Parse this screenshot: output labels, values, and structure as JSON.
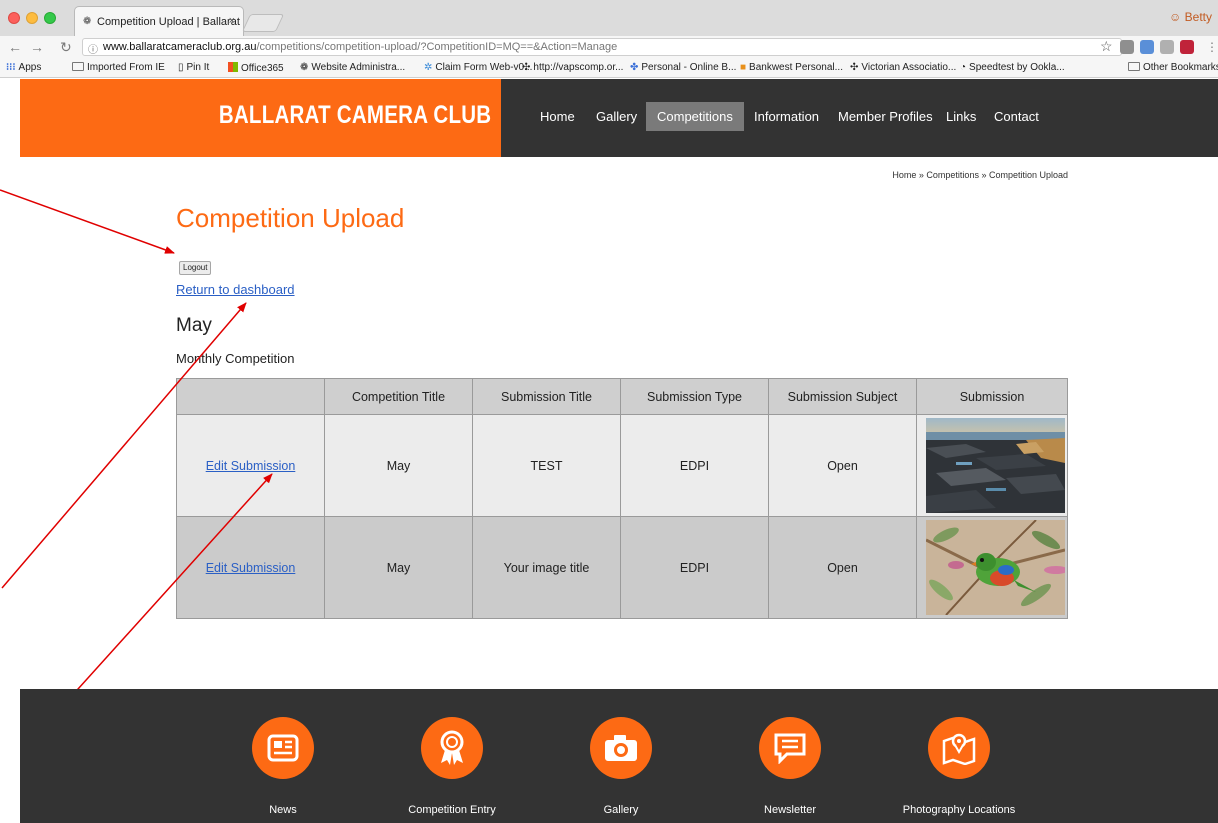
{
  "browser": {
    "tab_title": "Competition Upload | Ballarat C",
    "tab_close": "×",
    "profile_name": "Betty",
    "url_host": "www.ballaratcameraclub.org.au",
    "url_path": "/competitions/competition-upload/?CompetitionID=MQ==&Action=Manage",
    "bookmarks": [
      "Apps",
      "Imported From IE",
      "Pin It",
      "Office365",
      "Website Administra...",
      "Claim Form Web-v0...",
      "http://vapscomp.or...",
      "Personal - Online B...",
      "Bankwest Personal...",
      "Victorian Associatio...",
      "Speedtest by Ookla..."
    ],
    "other_bookmarks": "Other Bookmarks"
  },
  "site": {
    "brand": "BALLARAT CAMERA CLUB",
    "nav": [
      "Home",
      "Gallery",
      "Competitions",
      "Information",
      "Member Profiles",
      "Links",
      "Contact"
    ],
    "active_nav": "Competitions"
  },
  "breadcrumb": "Home » Competitions » Competition Upload",
  "page": {
    "title": "Competition Upload",
    "logout_label": "Logout",
    "dashboard_link": "Return to dashboard",
    "competition_name": "May",
    "competition_type": "Monthly Competition"
  },
  "table": {
    "headers": [
      "",
      "Competition Title",
      "Submission Title",
      "Submission Type",
      "Submission Subject",
      "Submission"
    ],
    "rows": [
      {
        "action": "Edit Submission",
        "competition_title": "May",
        "submission_title": "TEST",
        "submission_type": "EDPI",
        "submission_subject": "Open",
        "thumbnail": "rocky-coast-photo"
      },
      {
        "action": "Edit Submission",
        "competition_title": "May",
        "submission_title": "Your image title",
        "submission_type": "EDPI",
        "submission_subject": "Open",
        "thumbnail": "parrot-photo"
      }
    ]
  },
  "footer": {
    "items": [
      {
        "label": "News",
        "icon": "newspaper-icon"
      },
      {
        "label": "Competition Entry",
        "icon": "award-ribbon-icon"
      },
      {
        "label": "Gallery",
        "icon": "camera-icon"
      },
      {
        "label": "Newsletter",
        "icon": "message-icon"
      },
      {
        "label": "Photography Locations",
        "icon": "map-pin-icon"
      }
    ]
  },
  "colors": {
    "brand_orange": "#fd6a14",
    "dark_bar": "#333333",
    "link_blue": "#2a5fc5",
    "annotation_red": "#e00000"
  }
}
